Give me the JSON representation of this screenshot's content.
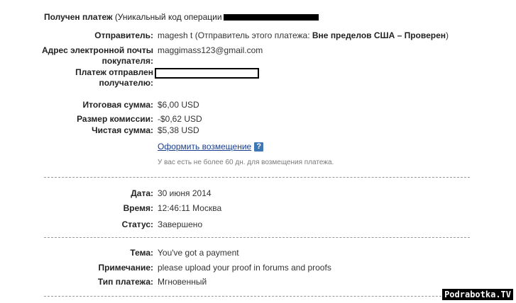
{
  "header": {
    "title": "Получен платеж",
    "opid_prefix": "(Уникальный код операции"
  },
  "sender": {
    "label": "Отправитель:",
    "name": "magesh t",
    "paren_prefix": "(Отправитель этого платежа:",
    "status": "Вне пределов США – Проверен",
    "paren_suffix": ")"
  },
  "buyer_email": {
    "label_line1": "Адрес электронной почты",
    "label_line2": "покупателя:",
    "value": "maggimass123@gmail.com"
  },
  "sent_to": {
    "label_line1": "Платеж отправлен",
    "label_line2": "получателю:"
  },
  "amounts": {
    "total_label": "Итоговая сумма:",
    "total": "$6,00 USD",
    "fee_label": "Размер комиссии:",
    "fee": "-$0,62 USD",
    "net_label": "Чистая сумма:",
    "net": "$5,38 USD"
  },
  "refund": {
    "link": "Оформить возмещение",
    "help_icon": "?",
    "note": "У вас есть не более 60 дн. для возмещения платежа."
  },
  "details": {
    "date_label": "Дата:",
    "date": "30 июня 2014",
    "time_label": "Время:",
    "time": "12:46:11 Москва",
    "status_label": "Статус:",
    "status": "Завершено"
  },
  "message": {
    "subject_label": "Тема:",
    "subject": "You've got a payment",
    "note_label": "Примечание:",
    "note": "please upload your proof in forums and proofs",
    "type_label": "Тип платежа:",
    "type": "Мгновенный"
  },
  "watermark": "Podrabotka.TV",
  "colors": {
    "link": "#1a3d8f",
    "help_icon_bg": "#3f77b5",
    "divider": "#999999"
  }
}
